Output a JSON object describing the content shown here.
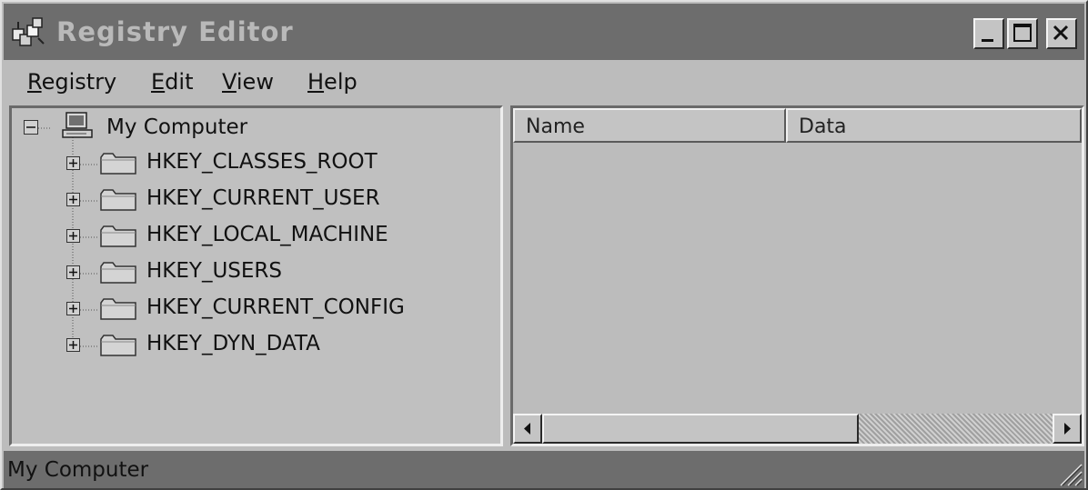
{
  "window": {
    "title": "Registry Editor",
    "icon": "registry-editor-icon",
    "controls": [
      "minimize-icon",
      "maximize-icon",
      "close-icon"
    ]
  },
  "menu": [
    {
      "pre": "",
      "accel": "R",
      "post": "egistry"
    },
    {
      "pre": "",
      "accel": "E",
      "post": "dit"
    },
    {
      "pre": "",
      "accel": "V",
      "post": "iew"
    },
    {
      "pre": "",
      "accel": "H",
      "post": "elp"
    }
  ],
  "tree": {
    "root": {
      "label": "My Computer",
      "icon": "computer-icon",
      "expanded": true
    },
    "keys": [
      {
        "label": "HKEY_CLASSES_ROOT",
        "icon": "folder-icon"
      },
      {
        "label": "HKEY_CURRENT_USER",
        "icon": "folder-icon"
      },
      {
        "label": "HKEY_LOCAL_MACHINE",
        "icon": "folder-icon"
      },
      {
        "label": "HKEY_USERS",
        "icon": "folder-icon"
      },
      {
        "label": "HKEY_CURRENT_CONFIG",
        "icon": "folder-icon"
      },
      {
        "label": "HKEY_DYN_DATA",
        "icon": "folder-icon"
      }
    ]
  },
  "list": {
    "columns": [
      "Name",
      "Data"
    ],
    "rows": []
  },
  "status": {
    "text": "My Computer"
  },
  "colors": {
    "titlebar": "#6d6d6d",
    "face": "#bcbcbc"
  }
}
